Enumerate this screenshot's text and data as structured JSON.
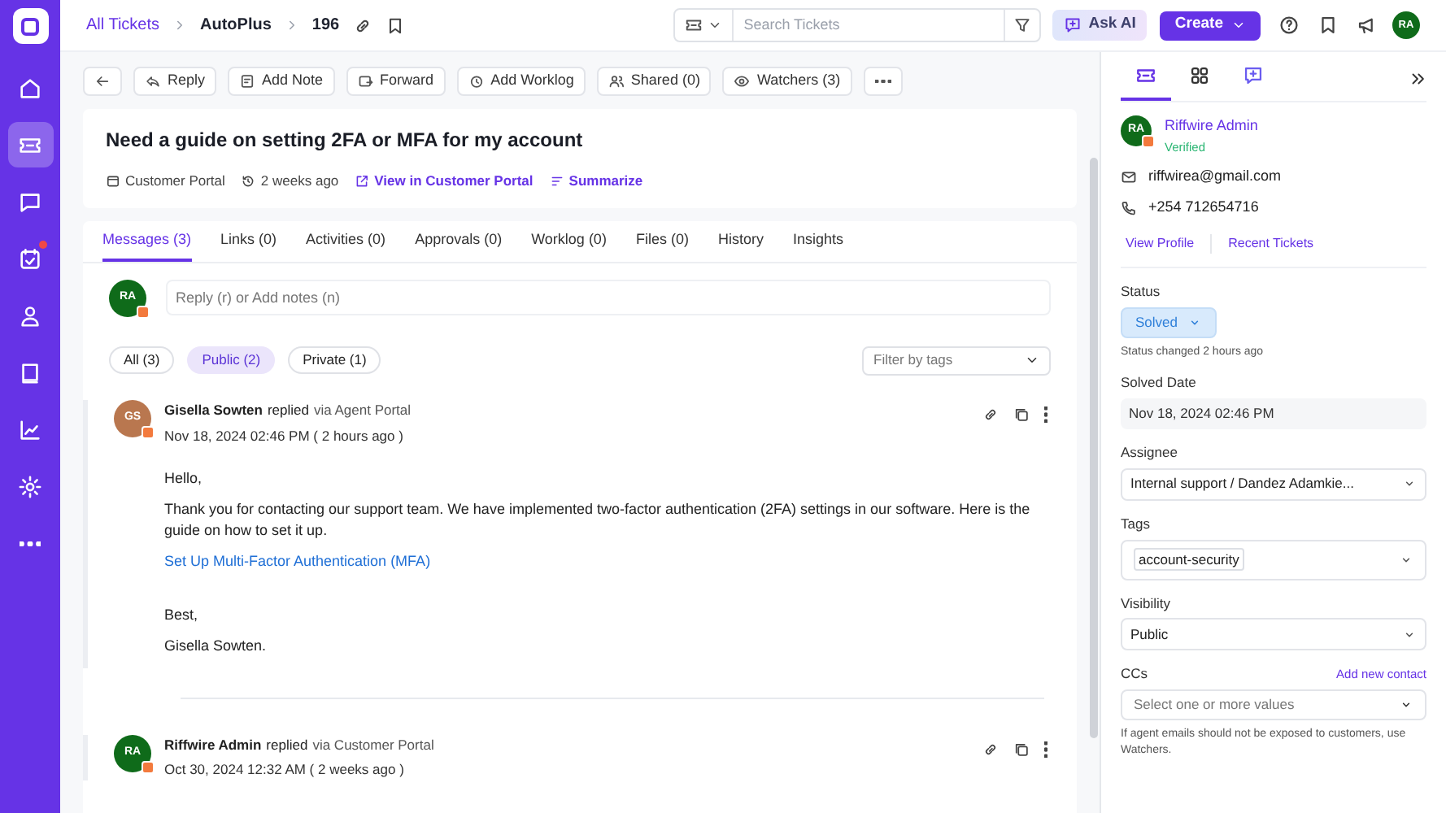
{
  "sidebar": {
    "items": [
      {
        "kind": "home",
        "selected": false,
        "badge": false
      },
      {
        "kind": "ticket",
        "selected": true,
        "badge": false
      },
      {
        "kind": "chat",
        "selected": false,
        "badge": false
      },
      {
        "kind": "tasks",
        "selected": false,
        "badge": true
      },
      {
        "kind": "user",
        "selected": false,
        "badge": false
      },
      {
        "kind": "book",
        "selected": false,
        "badge": false
      },
      {
        "kind": "chart",
        "selected": false,
        "badge": false
      },
      {
        "kind": "gear",
        "selected": false,
        "badge": false
      },
      {
        "kind": "more",
        "selected": false,
        "badge": false
      }
    ]
  },
  "breadcrumb": [
    "All Tickets",
    "AutoPlus",
    "196"
  ],
  "search": {
    "placeholder": "Search Tickets"
  },
  "ask_ai": "Ask AI",
  "create": "Create",
  "user_initials": "RA",
  "toolbar": [
    {
      "kind": "back"
    },
    {
      "kind": "reply",
      "label": "Reply"
    },
    {
      "kind": "note",
      "label": "Add Note"
    },
    {
      "kind": "forward",
      "label": "Forward"
    },
    {
      "kind": "worklog",
      "label": "Add Worklog"
    },
    {
      "kind": "shared",
      "label": "Shared (0)"
    },
    {
      "kind": "watchers",
      "label": "Watchers (3)"
    },
    {
      "kind": "more"
    }
  ],
  "ticket": {
    "title": "Need a guide on setting 2FA or MFA for my account",
    "source": "Customer Portal",
    "age": "2 weeks ago",
    "view_link": "View in Customer Portal",
    "summarize": "Summarize"
  },
  "tabs": [
    {
      "label": "Messages",
      "count": "(3)",
      "selected": true
    },
    {
      "label": "Links",
      "count": "(0)",
      "selected": false
    },
    {
      "label": "Activities",
      "count": "(0)",
      "selected": false
    },
    {
      "label": "Approvals",
      "count": "(0)",
      "selected": false
    },
    {
      "label": "Worklog",
      "count": "(0)",
      "selected": false
    },
    {
      "label": "Files",
      "count": "(0)",
      "selected": false
    },
    {
      "label": "History",
      "selected": false
    },
    {
      "label": "Insights",
      "selected": false
    }
  ],
  "reply_box": {
    "initials": "RA",
    "placeholder": "Reply (r) or Add notes (n)"
  },
  "filters": [
    {
      "label": "All (3)",
      "selected": false
    },
    {
      "label": "Public (2)",
      "selected": true
    },
    {
      "label": "Private (1)",
      "selected": false
    }
  ],
  "tag_filter": {
    "placeholder": "Filter by tags"
  },
  "messages": [
    {
      "initials": "GS",
      "color": "#b9774f",
      "author": "Gisella Sowten",
      "verb": "replied",
      "via": "via Agent Portal",
      "time": "Nov 18, 2024 02:46 PM ( 2 hours ago )",
      "body": [
        {
          "kind": "text",
          "text": "Hello,"
        },
        {
          "kind": "text",
          "text": "Thank you for contacting our support team. We have implemented two-factor authentication (2FA) settings in our software. Here is the guide on how to set it up."
        },
        {
          "kind": "link",
          "text": "Set Up Multi-Factor Authentication (MFA)"
        },
        {
          "kind": "gap"
        },
        {
          "kind": "text",
          "text": "Best,"
        },
        {
          "kind": "text",
          "text": "Gisella Sowten."
        }
      ]
    },
    {
      "initials": "RA",
      "color": "#0f6b1a",
      "author": "Riffwire Admin",
      "verb": "replied",
      "via": "via Customer Portal",
      "time": "Oct 30, 2024 12:32 AM ( 2 weeks ago )"
    }
  ],
  "panel_tabs": [
    {
      "kind": "ticket",
      "selected": true
    },
    {
      "kind": "grid",
      "selected": false
    },
    {
      "kind": "ai",
      "selected": false
    }
  ],
  "contact": {
    "initials": "RA",
    "name": "Riffwire Admin",
    "verified": "Verified",
    "email": "riffwirea@gmail.com",
    "phone": "+254 712654716",
    "links": [
      "View Profile",
      "Recent Tickets"
    ]
  },
  "fields": [
    {
      "kind": "status",
      "label": "Status",
      "value": "Solved",
      "note": "Status changed 2 hours ago"
    },
    {
      "kind": "readonly",
      "label": "Solved Date",
      "value": "Nov 18, 2024 02:46 PM"
    },
    {
      "kind": "select",
      "label": "Assignee",
      "value": "Internal support / Dandez Adamkie..."
    },
    {
      "kind": "tags",
      "label": "Tags",
      "value": "account-security"
    },
    {
      "kind": "select",
      "label": "Visibility",
      "value": "Public"
    },
    {
      "kind": "cc",
      "label": "CCs",
      "action": "Add new contact",
      "placeholder": "Select one or more values",
      "note": "If agent emails should not be exposed to customers, use Watchers."
    }
  ]
}
